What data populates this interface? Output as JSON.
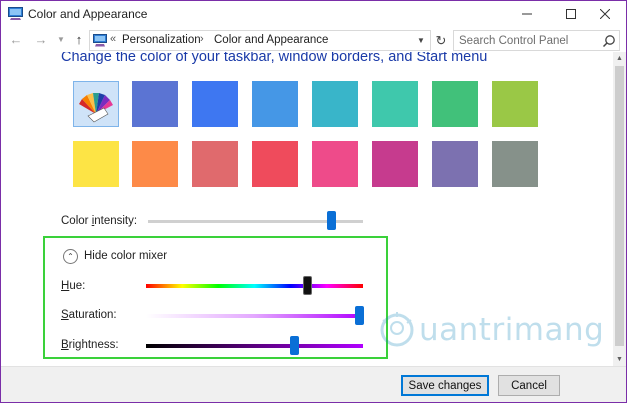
{
  "window": {
    "title": "Color and Appearance"
  },
  "address_bar": {
    "crumbs": [
      "Personalization",
      "Color and Appearance"
    ],
    "search_placeholder": "Search Control Panel"
  },
  "main": {
    "heading": "Change the color of your taskbar, window borders, and Start menu",
    "swatches": [
      {
        "name": "automatic",
        "color": "#cfe3f8",
        "selected": true
      },
      {
        "name": "slate-blue",
        "color": "#5b74d3"
      },
      {
        "name": "blue",
        "color": "#3e77f1"
      },
      {
        "name": "sky-blue",
        "color": "#4597e6"
      },
      {
        "name": "teal",
        "color": "#39b5c9"
      },
      {
        "name": "aqua-green",
        "color": "#3fc8ac"
      },
      {
        "name": "green",
        "color": "#41c17a"
      },
      {
        "name": "lime",
        "color": "#9ac846"
      },
      {
        "name": "yellow",
        "color": "#fde445"
      },
      {
        "name": "orange",
        "color": "#fd8a48"
      },
      {
        "name": "rose",
        "color": "#e06a6d"
      },
      {
        "name": "red",
        "color": "#ef4b5c"
      },
      {
        "name": "pink",
        "color": "#ee4b8a"
      },
      {
        "name": "magenta",
        "color": "#c63b8e"
      },
      {
        "name": "purple",
        "color": "#7c71b0"
      },
      {
        "name": "gray-green",
        "color": "#86918a"
      }
    ],
    "intensity": {
      "label_before": "Color ",
      "label_underlined": "i",
      "label_after": "ntensity:",
      "value": 0.85
    },
    "mixer": {
      "toggle_label": "Hide color mixer",
      "hue": {
        "label_underlined": "H",
        "label_after": "ue:",
        "value": 0.74
      },
      "saturation": {
        "label_underlined": "S",
        "label_after": "aturation:",
        "value": 0.98
      },
      "brightness": {
        "label_underlined": "B",
        "label_after": "rightness:",
        "value": 0.68
      }
    }
  },
  "watermark": {
    "text": "uantrimang"
  },
  "footer": {
    "save_label": "Save changes",
    "cancel_label": "Cancel"
  },
  "colors": {
    "accent": "#0078d7",
    "window_border": "#7a2ea8",
    "highlight_box": "#3ad13a",
    "heading": "#1a3aa8"
  }
}
